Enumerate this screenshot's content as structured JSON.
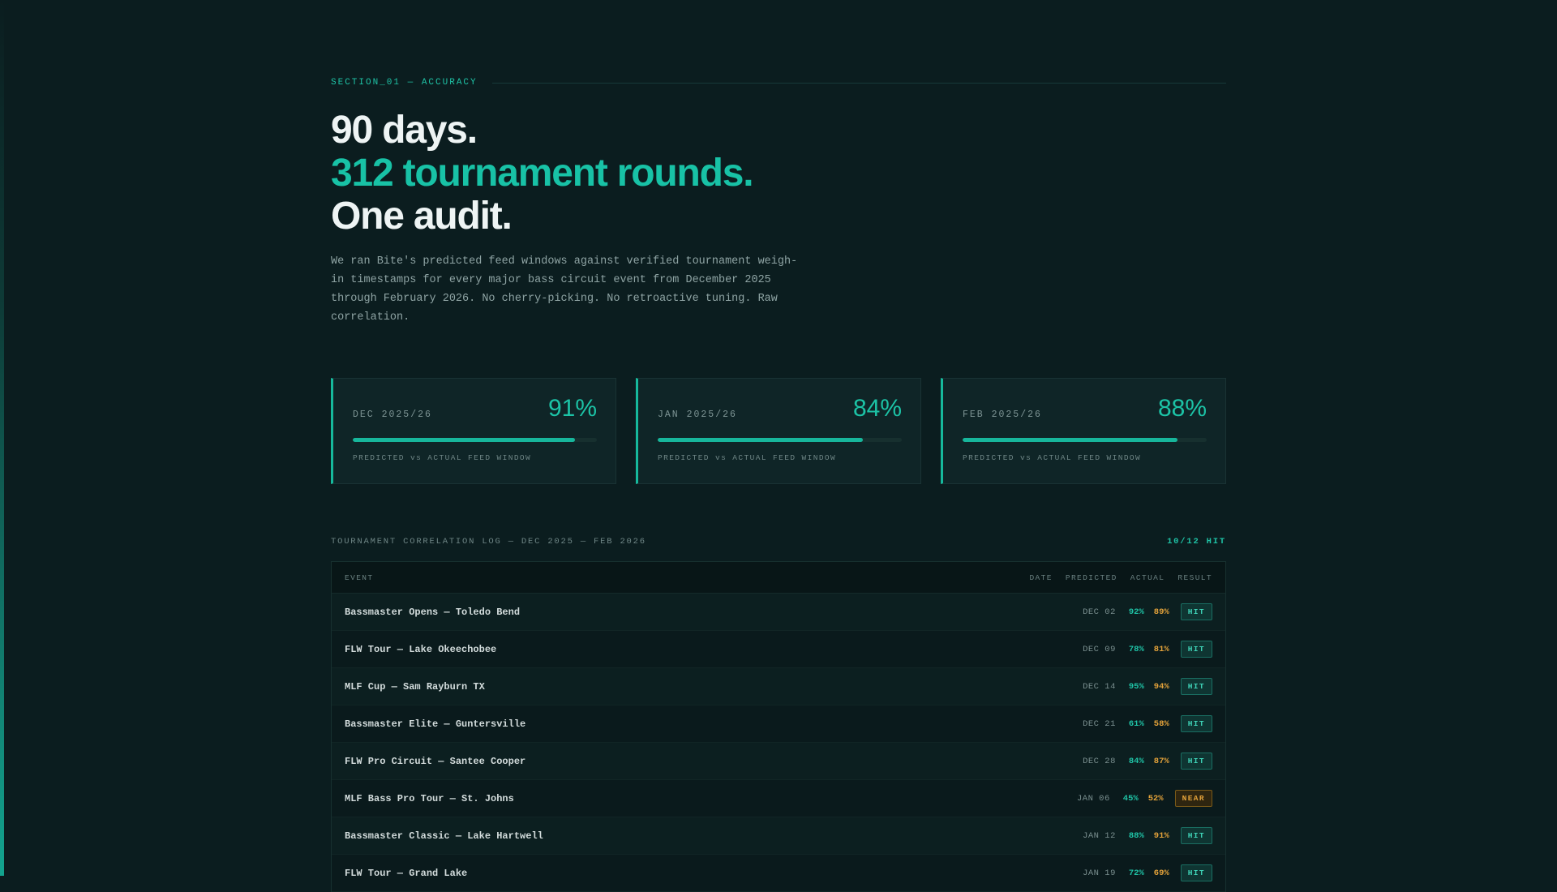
{
  "section": {
    "label": "SECTION_01 — ACCURACY"
  },
  "headline": {
    "line1": "90 days.",
    "line2": "312 tournament rounds.",
    "line3": "One audit."
  },
  "intro": "We ran Bite's predicted feed windows against verified tournament weigh-in timestamps for every major bass circuit event from December 2025 through February 2026. No cherry-picking. No retroactive tuning. Raw correlation.",
  "cards": [
    {
      "month": "DEC 2025/26",
      "pct": "91%",
      "value": 0.91,
      "caption": "PREDICTED vs ACTUAL FEED WINDOW"
    },
    {
      "month": "JAN 2025/26",
      "pct": "84%",
      "value": 0.84,
      "caption": "PREDICTED vs ACTUAL FEED WINDOW"
    },
    {
      "month": "FEB 2025/26",
      "pct": "88%",
      "value": 0.88,
      "caption": "PREDICTED vs ACTUAL FEED WINDOW"
    }
  ],
  "log": {
    "title": "TOURNAMENT CORRELATION LOG — DEC 2025 — FEB 2026",
    "count": "10/12 HIT",
    "columns": {
      "event": "EVENT",
      "date": "DATE",
      "predicted": "PREDICTED",
      "actual": "ACTUAL",
      "result": "RESULT"
    },
    "rows": [
      {
        "event": "Bassmaster Opens — Toledo Bend",
        "date": "DEC 02",
        "predicted": "92%",
        "actual": "89%",
        "result": "HIT"
      },
      {
        "event": "FLW Tour — Lake Okeechobee",
        "date": "DEC 09",
        "predicted": "78%",
        "actual": "81%",
        "result": "HIT"
      },
      {
        "event": "MLF Cup — Sam Rayburn TX",
        "date": "DEC 14",
        "predicted": "95%",
        "actual": "94%",
        "result": "HIT"
      },
      {
        "event": "Bassmaster Elite — Guntersville",
        "date": "DEC 21",
        "predicted": "61%",
        "actual": "58%",
        "result": "HIT"
      },
      {
        "event": "FLW Pro Circuit — Santee Cooper",
        "date": "DEC 28",
        "predicted": "84%",
        "actual": "87%",
        "result": "HIT"
      },
      {
        "event": "MLF Bass Pro Tour — St. Johns",
        "date": "JAN 06",
        "predicted": "45%",
        "actual": "52%",
        "result": "NEAR"
      },
      {
        "event": "Bassmaster Classic — Lake Hartwell",
        "date": "JAN 12",
        "predicted": "88%",
        "actual": "91%",
        "result": "HIT"
      },
      {
        "event": "FLW Tour — Grand Lake",
        "date": "JAN 19",
        "predicted": "72%",
        "actual": "69%",
        "result": "HIT"
      }
    ]
  }
}
